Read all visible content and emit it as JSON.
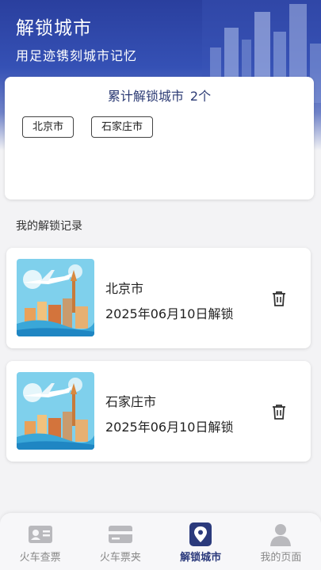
{
  "header": {
    "title": "解锁城市",
    "subtitle": "用足迹镌刻城市记忆"
  },
  "summary": {
    "title": "累计解锁城市",
    "count": "2个",
    "cities": [
      "北京市",
      "石家庄市"
    ]
  },
  "records": {
    "section_label": "我的解锁记录",
    "items": [
      {
        "city": "北京市",
        "date": "2025年06月10日解锁"
      },
      {
        "city": "石家庄市",
        "date": "2025年06月10日解锁"
      }
    ]
  },
  "tabbar": {
    "tabs": [
      {
        "label": "火车查票",
        "icon": "id-card-icon"
      },
      {
        "label": "火车票夹",
        "icon": "ticket-wallet-icon"
      },
      {
        "label": "解锁城市",
        "icon": "location-pin-icon",
        "active": true
      },
      {
        "label": "我的页面",
        "icon": "person-icon"
      }
    ]
  },
  "colors": {
    "header_blue": "#2a3f9e",
    "accent_navy": "#2b3a7c",
    "inactive_gray": "#888888"
  }
}
